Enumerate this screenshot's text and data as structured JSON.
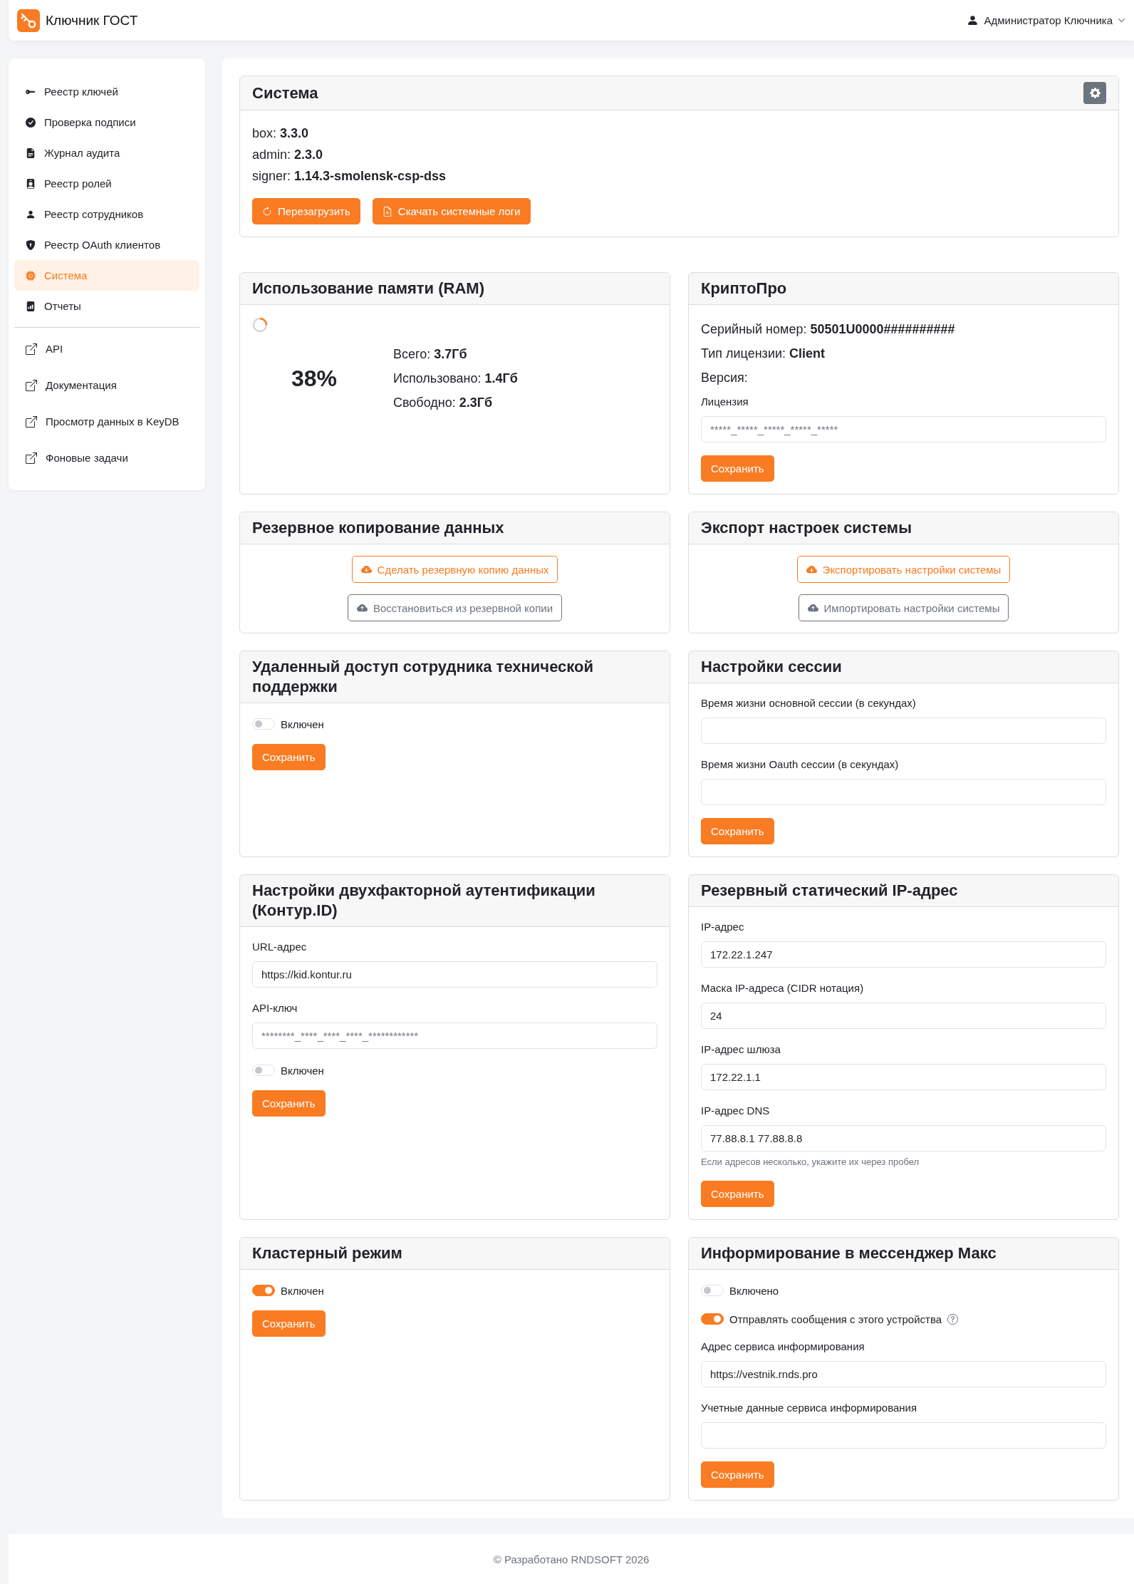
{
  "app": {
    "title": "Ключник ГОСТ"
  },
  "user_menu": {
    "name": "Администратор Ключника"
  },
  "sidebar": {
    "items": [
      {
        "label": "Реестр ключей",
        "selected": false
      },
      {
        "label": "Проверка подписи",
        "selected": false
      },
      {
        "label": "Журнал аудита",
        "selected": false
      },
      {
        "label": "Реестр ролей",
        "selected": false
      },
      {
        "label": "Реестр сотрудников",
        "selected": false
      },
      {
        "label": "Реестр OAuth клиентов",
        "selected": false
      },
      {
        "label": "Система",
        "selected": true
      },
      {
        "label": "Отчеты",
        "selected": false
      }
    ],
    "links": [
      "API",
      "Документация",
      "Просмотр данных в KeyDB",
      "Фоновые задачи"
    ]
  },
  "system": {
    "title": "Система",
    "versions": [
      "box: **3.3.0**",
      "admin: **2.3.0**",
      "signer: **1.14.3-smolensk-csp-dss**"
    ],
    "buttons": [
      "Перезагрузить",
      "Скачать системные логи"
    ]
  },
  "memory": {
    "title": "Использование памяти (RAM)",
    "percent": "38%",
    "stats": [
      "Всего: **3.7Гб**",
      "Использовано: **1.4Гб**",
      "Свободно: **2.3Гб**"
    ]
  },
  "cryptopro": {
    "title": "КриптоПро",
    "lines": [
      "Серийный номер: **50501U0000##########**",
      "Тип лицензии: **Client**",
      "Версия:"
    ],
    "license_field": {
      "label": "Лицензия",
      "placeholder": "*****_*****_*****_*****_*****"
    },
    "save_button": "Сохранить"
  },
  "backup": {
    "title": "Резервное копирование данных",
    "buttons": [
      {
        "label": "Сделать резервную копию данных",
        "kind": "primary"
      },
      {
        "label": "Восстановиться из резервной копии",
        "kind": "secondary"
      }
    ]
  },
  "settings_export": {
    "title": "Экспорт настроек системы",
    "buttons": [
      {
        "label": "Экспортировать настройки системы",
        "kind": "primary"
      },
      {
        "label": "Импортировать настройки системы",
        "kind": "secondary"
      }
    ]
  },
  "remote_support": {
    "title": "Удаленный доступ сотрудника технической поддержки",
    "toggle": {
      "label": "Включен",
      "on": false
    },
    "save_button": "Сохранить"
  },
  "session": {
    "title": "Настройки сессии",
    "fields": [
      {
        "label": "Время жизни основной сессии (в секундах)"
      },
      {
        "label": "Время жизни Oauth сессии (в секундах)"
      }
    ],
    "save_button": "Сохранить"
  },
  "two_factor": {
    "title": "Настройки двухфакторной аутентификации (Контур.ID)",
    "fields": [
      {
        "label": "URL-адрес",
        "value": "https://kid.kontur.ru"
      },
      {
        "label": "API-ключ",
        "placeholder": "********_****_****_****_************"
      }
    ],
    "toggle": {
      "label": "Включен",
      "on": false
    },
    "save_button": "Сохранить"
  },
  "static_ip": {
    "title": "Резервный статический IP-адрес",
    "fields": [
      {
        "label": "IP-адрес",
        "value": "172.22.1.247"
      },
      {
        "label": "Маска IP-адреса (CIDR нотация)",
        "value": "24"
      },
      {
        "label": "IP-адрес шлюза",
        "value": "172.22.1.1"
      },
      {
        "label": "IP-адрес DNS",
        "value": "77.88.8.1 77.88.8.8",
        "hint": "Если адресов несколько, укажите их через пробел"
      }
    ],
    "save_button": "Сохранить"
  },
  "cluster": {
    "title": "Кластерный режим",
    "toggle": {
      "label": "Включен",
      "on": true
    },
    "save_button": "Сохранить"
  },
  "max_messenger": {
    "title": "Информирование в мессенджер Макс",
    "toggles": [
      {
        "label": "Включено",
        "on": false,
        "help": false
      },
      {
        "label": "Отправлять сообщения с этого устройства",
        "on": true,
        "help": true
      }
    ],
    "fields": [
      {
        "label": "Адрес сервиса информирования",
        "value": "https://vestnik.rnds.pro"
      },
      {
        "label": "Учетные данные сервиса информирования"
      }
    ],
    "save_button": "Сохранить"
  },
  "footer": {
    "text": "© Разработано RNDSOFT 2026"
  }
}
